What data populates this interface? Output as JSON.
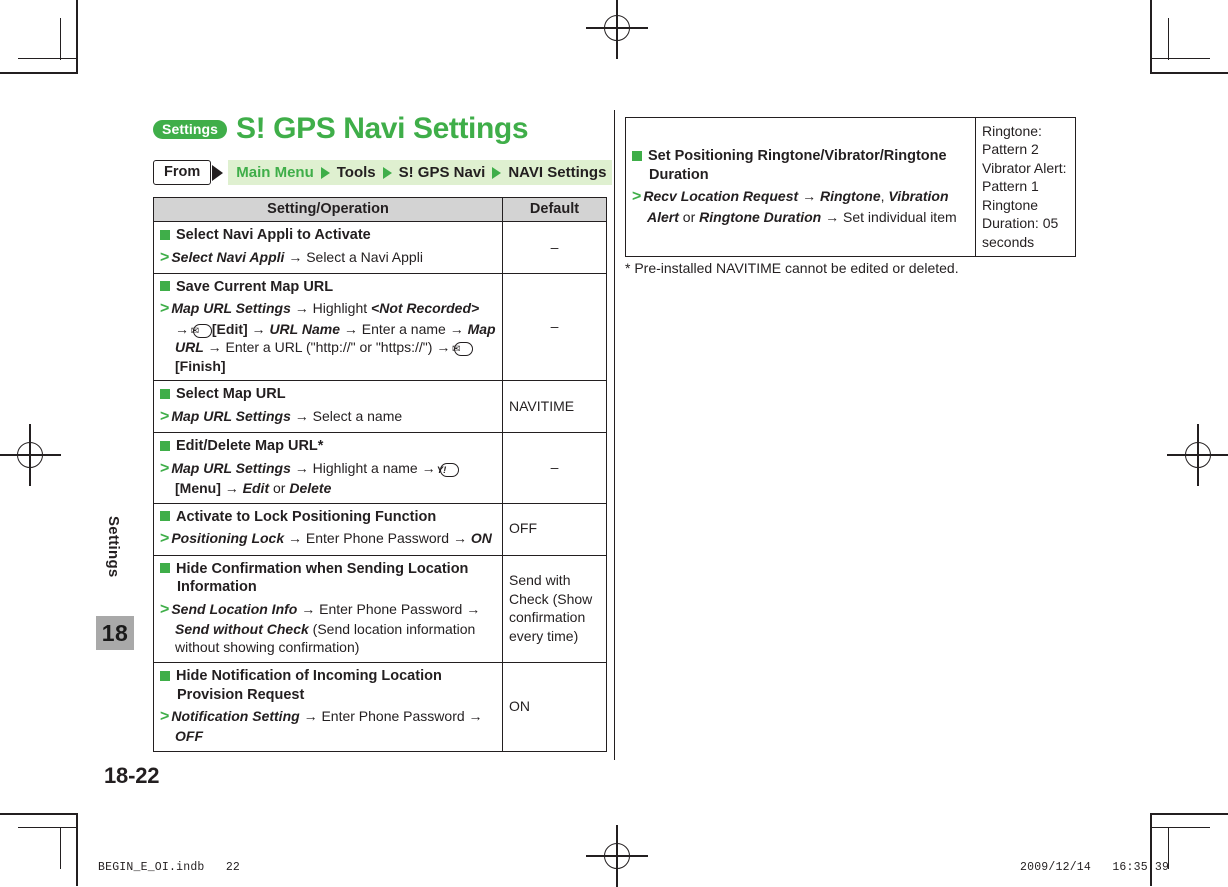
{
  "document": {
    "badge": "Settings",
    "title": "S! GPS Navi Settings",
    "side_label": "Settings",
    "side_number": "18",
    "page_number": "18-22"
  },
  "breadcrumb": {
    "from_label": "From",
    "items": [
      "Main Menu",
      "Tools",
      "S! GPS Navi",
      "NAVI Settings"
    ]
  },
  "table": {
    "headers": {
      "operation": "Setting/Operation",
      "default": "Default"
    },
    "rows": [
      {
        "heading": "Select Navi Appli to Activate",
        "operation_html": "<span class=\"gt\">&gt;</span><span class=\"bi\">Select Navi Appli</span> <span class=\"arr\">→</span> Select a Navi Appli",
        "default": "–",
        "default_center": true
      },
      {
        "heading": "Save Current Map URL",
        "operation_html": "<span class=\"gt\">&gt;</span><span class=\"bi\">Map URL Settings</span> <span class=\"arr\">→</span> Highlight <span class=\"bi\">&lt;Not Recorded&gt;</span> <span class=\"arr\">→</span> <span class=\"keyicon\">✉</span><b>[Edit]</b> <span class=\"arr\">→</span> <span class=\"bi\">URL Name</span> <span class=\"arr\">→</span> Enter a name <span class=\"arr\">→</span> <span class=\"bi\">Map URL</span> <span class=\"arr\">→</span> Enter a URL (\"http://\" or \"https://\") <span class=\"arr\">→</span> <span class=\"keyicon\">✉</span><b>[Finish]</b>",
        "default": "–",
        "default_center": true
      },
      {
        "heading": "Select Map URL",
        "operation_html": "<span class=\"gt\">&gt;</span><span class=\"bi\">Map URL Settings</span> <span class=\"arr\">→</span> Select a name",
        "default": "NAVITIME",
        "default_center": false
      },
      {
        "heading": "Edit/Delete Map URL*",
        "operation_html": "<span class=\"gt\">&gt;</span><span class=\"bi\">Map URL Settings</span> <span class=\"arr\">→</span> Highlight a name <span class=\"arr\">→</span> <span class=\"keyicon yk\">Y!</span><b>[Menu]</b> <span class=\"arr\">→</span> <span class=\"bi\">Edit</span> or <span class=\"bi\">Delete</span>",
        "default": "–",
        "default_center": true
      },
      {
        "heading": "Activate to Lock Positioning Function",
        "operation_html": "<span class=\"gt\">&gt;</span><span class=\"bi\">Positioning Lock</span> <span class=\"arr\">→</span> Enter Phone Password <span class=\"arr\">→</span> <span class=\"bi\">ON</span>",
        "default": "OFF",
        "default_center": false
      },
      {
        "heading": "Hide Confirmation when Sending Location Information",
        "operation_html": "<span class=\"gt\">&gt;</span><span class=\"bi\">Send Location Info</span> <span class=\"arr\">→</span> Enter Phone Password <span class=\"arr\">→</span> <span class=\"bi\">Send without Check</span> (Send location information without showing confirmation)",
        "default": "Send with Check (Show confirmation every time)",
        "default_center": false
      },
      {
        "heading": "Hide Notification of Incoming Location Provision Request",
        "operation_html": "<span class=\"gt\">&gt;</span><span class=\"bi\">Notification Setting</span> <span class=\"arr\">→</span> Enter Phone Password <span class=\"arr\">→</span> <span class=\"bi\">OFF</span>",
        "default": "ON",
        "default_center": false
      }
    ],
    "rows_right": [
      {
        "heading": "Set Positioning Ringtone/Vibrator/Ringtone Duration",
        "operation_html": "<span class=\"gt\">&gt;</span><span class=\"bi\">Recv Location Request</span> <span class=\"arr\">→</span> <span class=\"bi\">Ringtone</span>, <span class=\"bi\">Vibration Alert</span> or <span class=\"bi\">Ringtone Duration</span> <span class=\"arr\">→</span> Set individual item",
        "default": "Ringtone: Pattern 2 Vibrator Alert: Pattern 1 Ringtone Duration: 05 seconds",
        "default_center": false
      }
    ]
  },
  "footnote": "* Pre-installed NAVITIME cannot be edited or deleted.",
  "footer": {
    "left": "BEGIN_E_OI.indb   22",
    "right": "2009/12/14   16:35:39"
  },
  "colors": {
    "accent_green": "#3fae49",
    "crumb_bg": "#dff0d0",
    "header_gray": "#d3d3d3",
    "tab_gray": "#a9a9a9"
  }
}
